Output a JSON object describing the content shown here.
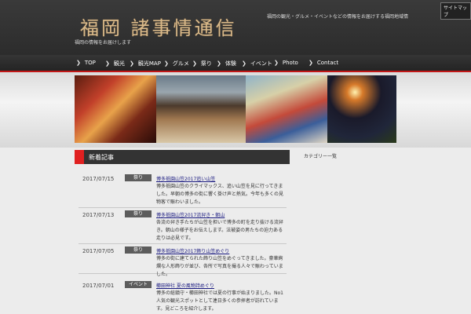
{
  "header": {
    "logo": "福岡 諸事情通信",
    "tagline": "福岡の情報をお届けします",
    "description": "福岡の観光・グルメ・イベントなどの情報をお届けする福岡地域情報ブログです。",
    "sitemap_label": "サイトマップ"
  },
  "nav": {
    "items": [
      {
        "label": "TOP"
      },
      {
        "label": "観光"
      },
      {
        "label": "観光MAP"
      },
      {
        "label": "グルメ"
      },
      {
        "label": "祭り"
      },
      {
        "label": "体験"
      },
      {
        "label": "イベント"
      },
      {
        "label": "Photo"
      },
      {
        "label": "Contact"
      }
    ]
  },
  "section": {
    "title": "新着記事"
  },
  "sidebar": {
    "title": "カテゴリー一覧"
  },
  "posts": [
    {
      "date": "2017/07/15",
      "category": "祭り",
      "title": "博多祇園山笠2017追い山笠",
      "excerpt": "博多祇園山笠のクライマックス、追い山笠を見に行ってきました。早朝の博多の街に響く掛け声と熱気。今年も多くの見物客で賑わいました。"
    },
    {
      "date": "2017/07/13",
      "category": "祭り",
      "title": "博多祇園山笠2017流舁き・朝山",
      "excerpt": "各流の舁き手たちが山笠を担いで博多の町を走り抜ける流舁き。朝山の様子をお伝えします。法被姿の男たちの迫力ある走りは必見です。"
    },
    {
      "date": "2017/07/05",
      "category": "祭り",
      "title": "博多祇園山笠2017飾り山笠めぐり",
      "excerpt": "博多の街に建てられた飾り山笠をめぐってきました。豪華絢爛な人形飾りが並び、各所で写真を撮る人々で賑わっていました。"
    },
    {
      "date": "2017/07/01",
      "category": "イベント",
      "title": "櫛田神社 夏の風物詩めぐり",
      "excerpt": "博多の総鎮守・櫛田神社では夏の行事が始まりました。No1人気の観光スポットとして連日多くの参拝者が訪れています。見どころを紹介します。"
    }
  ]
}
